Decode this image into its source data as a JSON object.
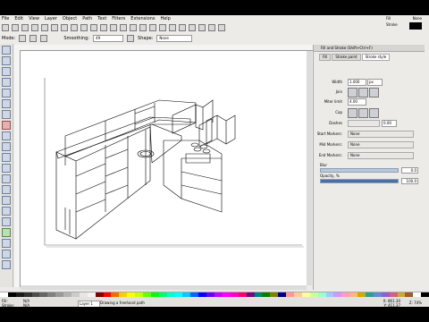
{
  "menu": [
    "File",
    "Edit",
    "View",
    "Layer",
    "Object",
    "Path",
    "Text",
    "Filters",
    "Extensions",
    "Help"
  ],
  "fill_stroke": {
    "fill_label": "Fill",
    "fill_value": "None",
    "stroke_label": "Stroke"
  },
  "toolbar": {
    "mode_label": "Mode:",
    "smoothing_label": "Smoothing:",
    "smoothing_value": "49",
    "shape_label": "Shape:",
    "shape_value": "None"
  },
  "panel": {
    "title": "Fill and Stroke (Shift+Ctrl+F)",
    "tabs": [
      "Fill",
      "Stroke paint",
      "Stroke style"
    ],
    "width_label": "Width",
    "width_value": "1.000",
    "width_unit": "px",
    "join_label": "Join",
    "miter_label": "Miter limit",
    "miter_value": "4.00",
    "cap_label": "Cap",
    "dashes_label": "Dashes",
    "dashes_value": "0.00",
    "start_markers_label": "Start Markers:",
    "start_markers_value": "None",
    "mid_markers_label": "Mid Markers:",
    "mid_markers_value": "None",
    "end_markers_label": "End Markers:",
    "end_markers_value": "None",
    "blur_label": "Blur",
    "blur_value": "0.0",
    "blur_fraction": 0.0,
    "opacity_label": "Opacity, %",
    "opacity_value": "100.0",
    "opacity_fraction": 1.0
  },
  "status": {
    "fill_label": "Fill:",
    "fill_value": "N/A",
    "stroke_label": "Stroke:",
    "stroke_value": "N/A",
    "layer": "Layer 1",
    "message": "Drawing a freehand path",
    "x_label": "X:",
    "x_value": "861.30",
    "y_label": "Y:",
    "y_value": "411.37",
    "zoom_label": "Z:",
    "zoom_value": "74%"
  },
  "palette_colors": [
    "#ffffff",
    "#000000",
    "#1a1a1a",
    "#333333",
    "#4d4d4d",
    "#666666",
    "#808080",
    "#999999",
    "#b3b3b3",
    "#cccccc",
    "#e6e6e6",
    "#f2f2f2",
    "#800000",
    "#ff0000",
    "#ff6600",
    "#ffcc00",
    "#ffff00",
    "#ccff00",
    "#66ff00",
    "#00ff00",
    "#00ff66",
    "#00ffcc",
    "#00ffff",
    "#00ccff",
    "#0066ff",
    "#0000ff",
    "#6600ff",
    "#cc00ff",
    "#ff00ff",
    "#ff00cc",
    "#ff0066",
    "#800080",
    "#008080",
    "#008000",
    "#808000",
    "#000080",
    "#ff9999",
    "#ffcc99",
    "#ffff99",
    "#ccff99",
    "#99ffcc",
    "#99ccff",
    "#cc99ff",
    "#ff99cc",
    "#ffb380",
    "#d4aa00",
    "#2ca089",
    "#5f8dd3",
    "#8d5fd3",
    "#d35f8d",
    "#c8ab37",
    "#a05a2c",
    "#ffffff",
    "#000000"
  ]
}
